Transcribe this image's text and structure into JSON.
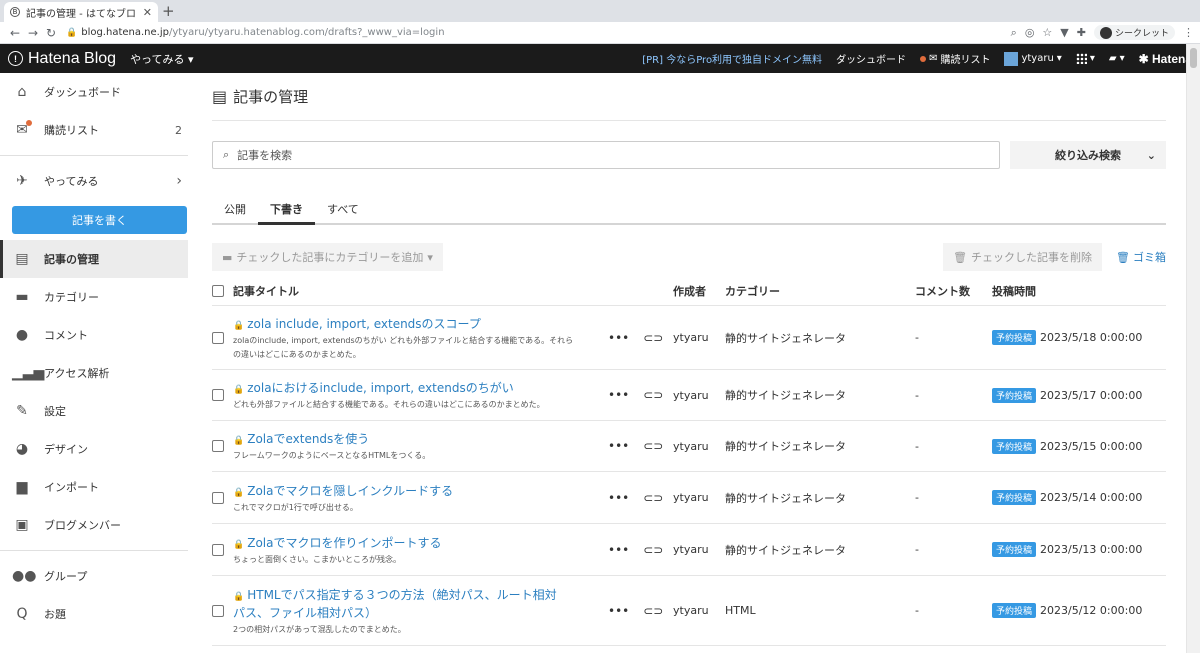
{
  "browser": {
    "tab_title": "記事の管理 - はてなブロ",
    "url_host": "blog.hatena.ne.jp",
    "url_path": "/ytyaru/ytyaru.hatenablog.com/drafts?_www_via=login",
    "incognito_label": "シークレット"
  },
  "header": {
    "logo": "Hatena Blog",
    "try_label": "やってみる",
    "pr_link": "[PR] 今ならPro利用で独自ドメイン無料",
    "dashboard": "ダッシュボード",
    "reading_list": "購読リスト",
    "user": "ytyaru",
    "brand": "Hatena"
  },
  "sidebar": {
    "dashboard": "ダッシュボード",
    "reading_list": "購読リスト",
    "reading_count": "2",
    "try": "やってみる",
    "write_button": "記事を書く",
    "manage": "記事の管理",
    "category": "カテゴリー",
    "comment": "コメント",
    "analytics": "アクセス解析",
    "settings": "設定",
    "design": "デザイン",
    "import": "インポート",
    "members": "ブログメンバー",
    "group": "グループ",
    "topic": "お題"
  },
  "main": {
    "title": "記事の管理",
    "search_placeholder": "記事を検索",
    "filter_button": "絞り込み検索",
    "tabs": [
      "公開",
      "下書き",
      "すべて"
    ],
    "add_category_button": "チェックした記事にカテゴリーを追加",
    "delete_button": "チェックした記事を削除",
    "trash_link": "ゴミ箱",
    "columns": {
      "title": "記事タイトル",
      "author": "作成者",
      "category": "カテゴリー",
      "comments": "コメント数",
      "date": "投稿時間"
    },
    "rows": [
      {
        "title": "zola include, import, extendsのスコープ",
        "desc1": "zolaのinclude, import, extendsのちがい どれも外部ファイルと結合する機能である。それら",
        "desc2": "の違いはどこにあるのかまとめた。",
        "author": "ytyaru",
        "category": "静的サイトジェネレータ",
        "comments": "-",
        "badge": "予約投稿",
        "date": "2023/5/18 0:00:00"
      },
      {
        "title": "zolaにおけるinclude, import, extendsのちがい",
        "desc1": "どれも外部ファイルと結合する機能である。それらの違いはどこにあるのかまとめた。",
        "author": "ytyaru",
        "category": "静的サイトジェネレータ",
        "comments": "-",
        "badge": "予約投稿",
        "date": "2023/5/17 0:00:00"
      },
      {
        "title": "Zolaでextendsを使う",
        "desc1": "フレームワークのようにベースとなるHTMLをつくる。",
        "author": "ytyaru",
        "category": "静的サイトジェネレータ",
        "comments": "-",
        "badge": "予約投稿",
        "date": "2023/5/15 0:00:00"
      },
      {
        "title": "Zolaでマクロを隠しインクルードする",
        "desc1": "これでマクロが1行で呼び出せる。",
        "author": "ytyaru",
        "category": "静的サイトジェネレータ",
        "comments": "-",
        "badge": "予約投稿",
        "date": "2023/5/14 0:00:00"
      },
      {
        "title": "Zolaでマクロを作りインポートする",
        "desc1": "ちょっと面倒くさい。こまかいところが残念。",
        "author": "ytyaru",
        "category": "静的サイトジェネレータ",
        "comments": "-",
        "badge": "予約投稿",
        "date": "2023/5/13 0:00:00"
      },
      {
        "title": "HTMLでパス指定する３つの方法（絶対パス、ルート相対",
        "title2": "パス、ファイル相対パス）",
        "desc1": "2つの相対パスがあって混乱したのでまとめた。",
        "author": "ytyaru",
        "category": "HTML",
        "comments": "-",
        "badge": "予約投稿",
        "date": "2023/5/12 0:00:00"
      }
    ]
  }
}
